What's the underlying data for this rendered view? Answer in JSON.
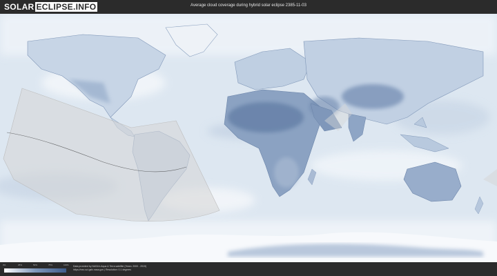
{
  "header": {
    "logo_part1": "SOLAR",
    "logo_part2": "ECLIPSE.INFO",
    "title": "Average cloud coverage during hybrid solar eclipse 2385-11-03"
  },
  "legend": {
    "ticks": [
      "0%",
      "25%",
      "50%",
      "75%",
      "100%"
    ],
    "colors": {
      "clear": "#ffffff",
      "cloudy": "#3e5c8a"
    }
  },
  "footer": {
    "credit_line1": "Data provided by NASA's Aqua & Terra satellite (Years: 2000 - 2019)",
    "credit_line2": "https://neo.sci.gsfc.nasa.gov | Resolution: 0.1 degrees"
  },
  "map": {
    "type": "world cloud coverage map",
    "eclipse_zone_color": "#d0d0d0"
  }
}
